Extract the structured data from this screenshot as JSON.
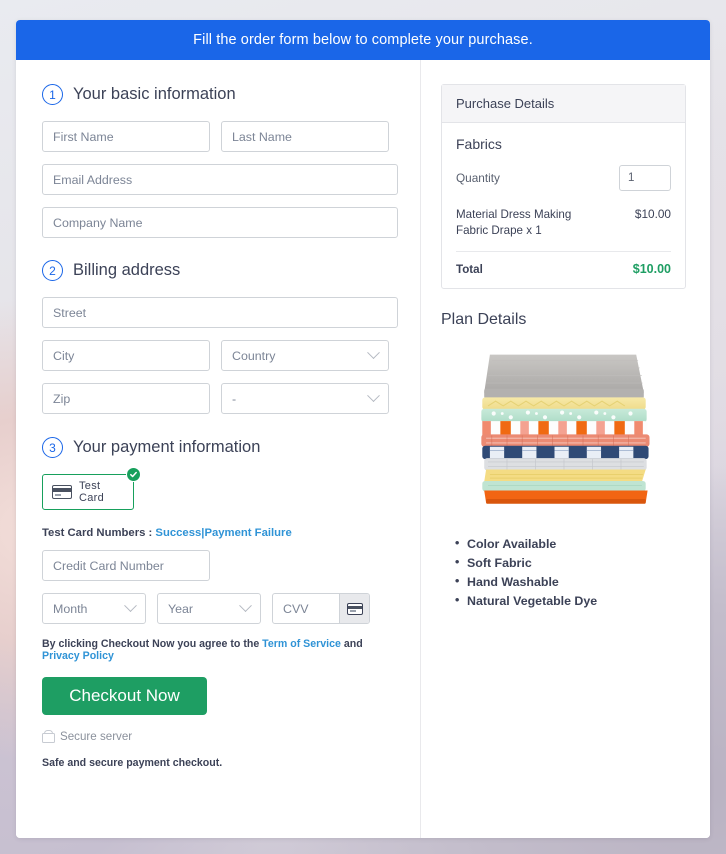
{
  "banner": {
    "text": "Fill the order form below to complete your purchase."
  },
  "basic_info": {
    "step": "1",
    "title": "Your basic information",
    "first_name_placeholder": "First Name",
    "last_name_placeholder": "Last Name",
    "email_placeholder": "Email Address",
    "company_placeholder": "Company Name"
  },
  "billing": {
    "step": "2",
    "title": "Billing address",
    "street_placeholder": "Street",
    "city_placeholder": "City",
    "country_placeholder": "Country",
    "zip_placeholder": "Zip",
    "state_placeholder": "-"
  },
  "payment": {
    "step": "3",
    "title": "Your payment information",
    "card_option_label": "Test  Card",
    "card_icon": "credit-card-icon",
    "selected_badge_icon": "check-circle-icon",
    "test_numbers_prefix": "Test Card Numbers :",
    "success_link": "Success",
    "separator": "|",
    "failure_link": "Payment Failure",
    "credit_card_placeholder": "Credit Card Number",
    "month_placeholder": "Month",
    "year_placeholder": "Year",
    "cvv_placeholder": "CVV",
    "cvv_icon": "credit-card-icon",
    "agree_prefix": "By clicking Checkout Now you agree to the",
    "terms_link": "Term of Service",
    "agree_mid": "and",
    "privacy_link": "Privacy Policy",
    "checkout_button": "Checkout Now",
    "lock_icon": "lock-icon",
    "secure_text": "Secure server",
    "safe_text": "Safe and secure payment checkout."
  },
  "purchase_details": {
    "header": "Purchase Details",
    "product_group": "Fabrics",
    "quantity_label": "Quantity",
    "quantity_value": "1",
    "item_name": "Material Dress Making Fabric Drape x 1",
    "item_price": "$10.00",
    "total_label": "Total",
    "total_value": "$10.00"
  },
  "plan_details": {
    "title": "Plan Details",
    "image_alt": "stacked-folded-fabrics-image",
    "features": [
      "Color Available",
      "Soft Fabric",
      "Hand Washable",
      "Natural Vegetable Dye"
    ]
  },
  "colors": {
    "banner_blue": "#1a66e8",
    "accent_blue": "#1a66e8",
    "success_green": "#1e9e63",
    "selected_green": "#17a05c",
    "link_blue": "#2f93d6",
    "text_dark": "#3c4257",
    "placeholder_gray": "#7c8596"
  }
}
